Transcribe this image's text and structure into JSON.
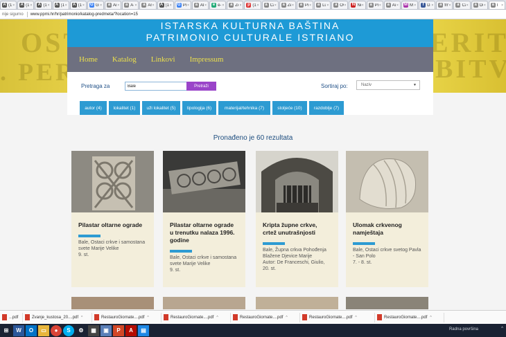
{
  "browser": {
    "tabs": [
      {
        "label": "(1)",
        "icon": "A"
      },
      {
        "label": "(1)",
        "icon": "A"
      },
      {
        "label": "(1)",
        "icon": "A"
      },
      {
        "label": "(1)",
        "icon": "A"
      },
      {
        "label": "(1)",
        "icon": "A"
      },
      {
        "label": "Go",
        "icon": "G"
      },
      {
        "label": "An",
        "icon": "a"
      },
      {
        "label": "A-L",
        "icon": "a"
      },
      {
        "label": "An",
        "icon": "a"
      },
      {
        "label": "(1)",
        "icon": "A"
      },
      {
        "label": "Pre",
        "icon": "G"
      },
      {
        "label": "Ak",
        "icon": "a"
      },
      {
        "label": "e-L",
        "icon": "e"
      },
      {
        "label": "Ze",
        "icon": "a"
      },
      {
        "label": "(1)",
        "icon": "p"
      },
      {
        "label": "Ca",
        "icon": "a"
      },
      {
        "label": "Zel",
        "icon": "a"
      },
      {
        "label": "Pre",
        "icon": "a"
      },
      {
        "label": "Lu",
        "icon": "a"
      },
      {
        "label": "Ov",
        "icon": "a"
      },
      {
        "label": "Ne",
        "icon": "N"
      },
      {
        "label": "Pre",
        "icon": "a"
      },
      {
        "label": "Au",
        "icon": "a"
      },
      {
        "label": "Mr",
        "icon": "M"
      },
      {
        "label": "Da",
        "icon": "f"
      },
      {
        "label": "fm",
        "icon": "a"
      },
      {
        "label": "Ca",
        "icon": "a"
      },
      {
        "label": "Oc",
        "icon": "a"
      },
      {
        "label": "I",
        "icon": "a"
      }
    ],
    "security_label": "nije sigurno",
    "url": "www.ppmi.hr/hr/patrimonio/katalog-predmeta/?location=15"
  },
  "header": {
    "title_hr": "ISTARSKA KULTURNA BAŠTINA",
    "title_it": "PATRIMONIO CULTURALE ISTRIANO"
  },
  "banner_text": [
    "OST",
    "ERIT",
    ". PER",
    "BITV"
  ],
  "nav": {
    "items": [
      "Home",
      "Katalog",
      "Linkovi",
      "Impressum"
    ]
  },
  "search": {
    "label": "Pretraga za",
    "value": "Bale",
    "button": "Pretraži",
    "sort_label": "Sortiraj po:",
    "sort_value": "Naziv"
  },
  "filters": [
    "autor (4)",
    "lokalitet (1)",
    "uži lokalitet (5)",
    "tipologija (6)",
    "materijal/tehnika (7)",
    "stoljeće (10)",
    "razdoblje (7)"
  ],
  "results": {
    "title": "Pronađeno je 60 rezultata"
  },
  "cards": [
    {
      "title": "Pilastar oltarne ograde",
      "desc": "Bale, Ostaci crkve i samostana svete Marije Velike",
      "meta": "9. st."
    },
    {
      "title": "Pilastar oltarne ograde u trenutku nalaza 1996. godine",
      "desc": "Bale, Ostaci crkve i samostana svete Marije Velike",
      "meta": "9. st."
    },
    {
      "title": "Kripta župne crkve, crtež unutrašnjosti",
      "desc": "Bale, Župna crkva Pohođenja Blažene Djevice Marije",
      "meta": "Autor: De Franceschi, Giulio, 20. st."
    },
    {
      "title": "Ulomak crkvenog namještaja",
      "desc": "Bale, Ostaci crkve svetog Pavla - San Polo",
      "meta": "7. - 8. st."
    }
  ],
  "downloads": [
    "...pdf",
    "Zvanje_kustosa_20....pdf",
    "RestauroGiornate....pdf",
    "RestauroGiornate....pdf",
    "RestauroGiornate....pdf",
    "RestauroGiornate....pdf",
    "RestauroGiornate....pdf"
  ],
  "taskbar": {
    "status": "Radna površina",
    "time": "^"
  },
  "colors": {
    "accent": "#2d9bd2",
    "header_blue": "#1e9ad6",
    "nav_bg": "#6e7080",
    "nav_text": "#ece04c",
    "search_button": "#9a44c9",
    "banner_yellow": "#e6cc3a",
    "card_bg": "#f3eedb"
  }
}
